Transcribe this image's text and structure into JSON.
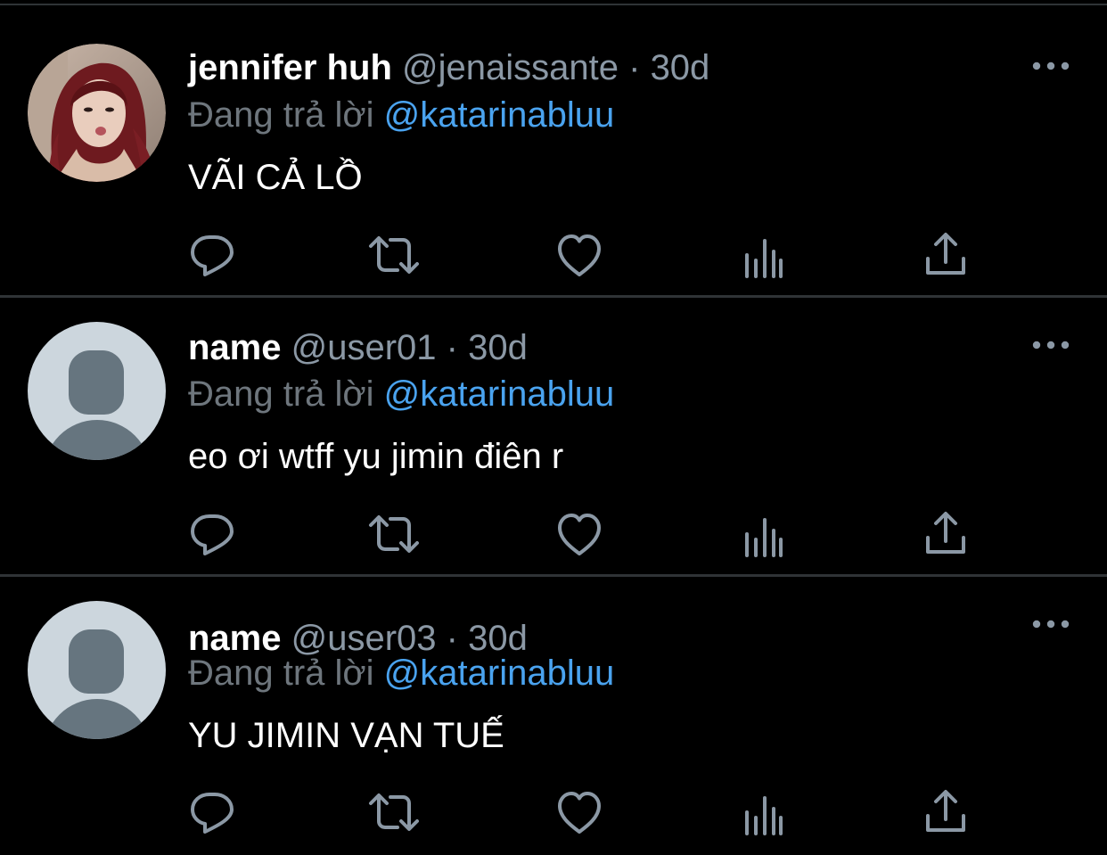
{
  "reply_prefix": "Đang trả lời",
  "tweets": [
    {
      "display_name": "jennifer huh",
      "handle": "@jenaissante",
      "separator": "·",
      "time": "30d",
      "mention": "@katarinabluu",
      "text": "VÃI CẢ LỒ",
      "avatar": "profile-photo"
    },
    {
      "display_name": "name",
      "handle": "@user01",
      "separator": "·",
      "time": "30d",
      "mention": "@katarinabluu",
      "text": "eo ơi wtff yu jimin điên r",
      "avatar": "default-avatar"
    },
    {
      "display_name": "name",
      "handle": "@user03",
      "separator": "·",
      "time": "30d",
      "mention": "@katarinabluu",
      "text": "YU JIMIN VẠN TUẾ",
      "avatar": "default-avatar"
    }
  ],
  "icons": {
    "more": "more-icon",
    "reply": "reply-icon",
    "retweet": "retweet-icon",
    "like": "heart-icon",
    "stats": "analytics-icon",
    "share": "share-icon"
  },
  "colors": {
    "background": "#000000",
    "divider": "#2f3336",
    "primary_text": "#ffffff",
    "secondary_text": "#8b98a5",
    "mention": "#4aa3ef",
    "icon": "#8b98a5"
  }
}
